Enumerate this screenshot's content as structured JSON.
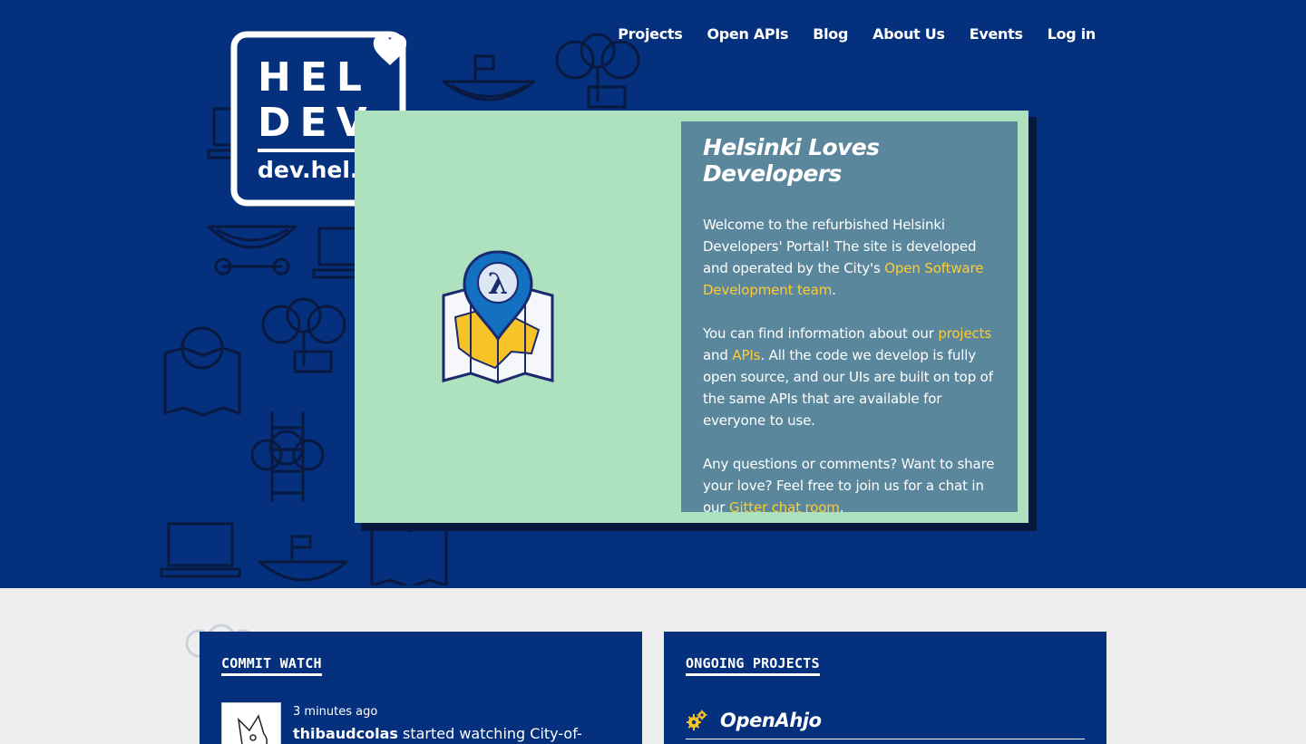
{
  "nav": {
    "items": [
      "Projects",
      "Open APIs",
      "Blog",
      "About Us",
      "Events",
      "Log in"
    ]
  },
  "logo": {
    "line1": "HEL",
    "line2": "DEV",
    "domain": "dev.hel.fi"
  },
  "feature": {
    "title": "Helsinki Loves Developers",
    "p1_a": "Welcome to the refurbished Helsinki Developers' Portal! The site is developed and operated by the City's ",
    "p1_link": "Open Software Development team",
    "p1_b": ".",
    "p2_a": "You can find information about our ",
    "p2_link1": "projects",
    "p2_and": " and ",
    "p2_link2": "APIs",
    "p2_b": ". All the code we develop is fully open source, and our UIs are built on top of the same APIs that are available for everyone to use.",
    "p3_a": "Any questions or comments? Want to share your love? Feel free to join us for a chat in our ",
    "p3_link": "Gitter chat room",
    "p3_b": "."
  },
  "commit_watch": {
    "heading": "COMMIT WATCH",
    "time": "3 minutes ago",
    "user": "thibaudcolas",
    "action": " started watching City-of-"
  },
  "projects": {
    "heading": "ONGOING PROJECTS",
    "items": [
      "OpenAhjo"
    ]
  },
  "colors": {
    "hero_bg": "#04307e",
    "card_bg": "#aee1be",
    "text_panel_bg": "#5b879d",
    "link": "#ffcc33",
    "page_bg": "#eeeeee"
  }
}
